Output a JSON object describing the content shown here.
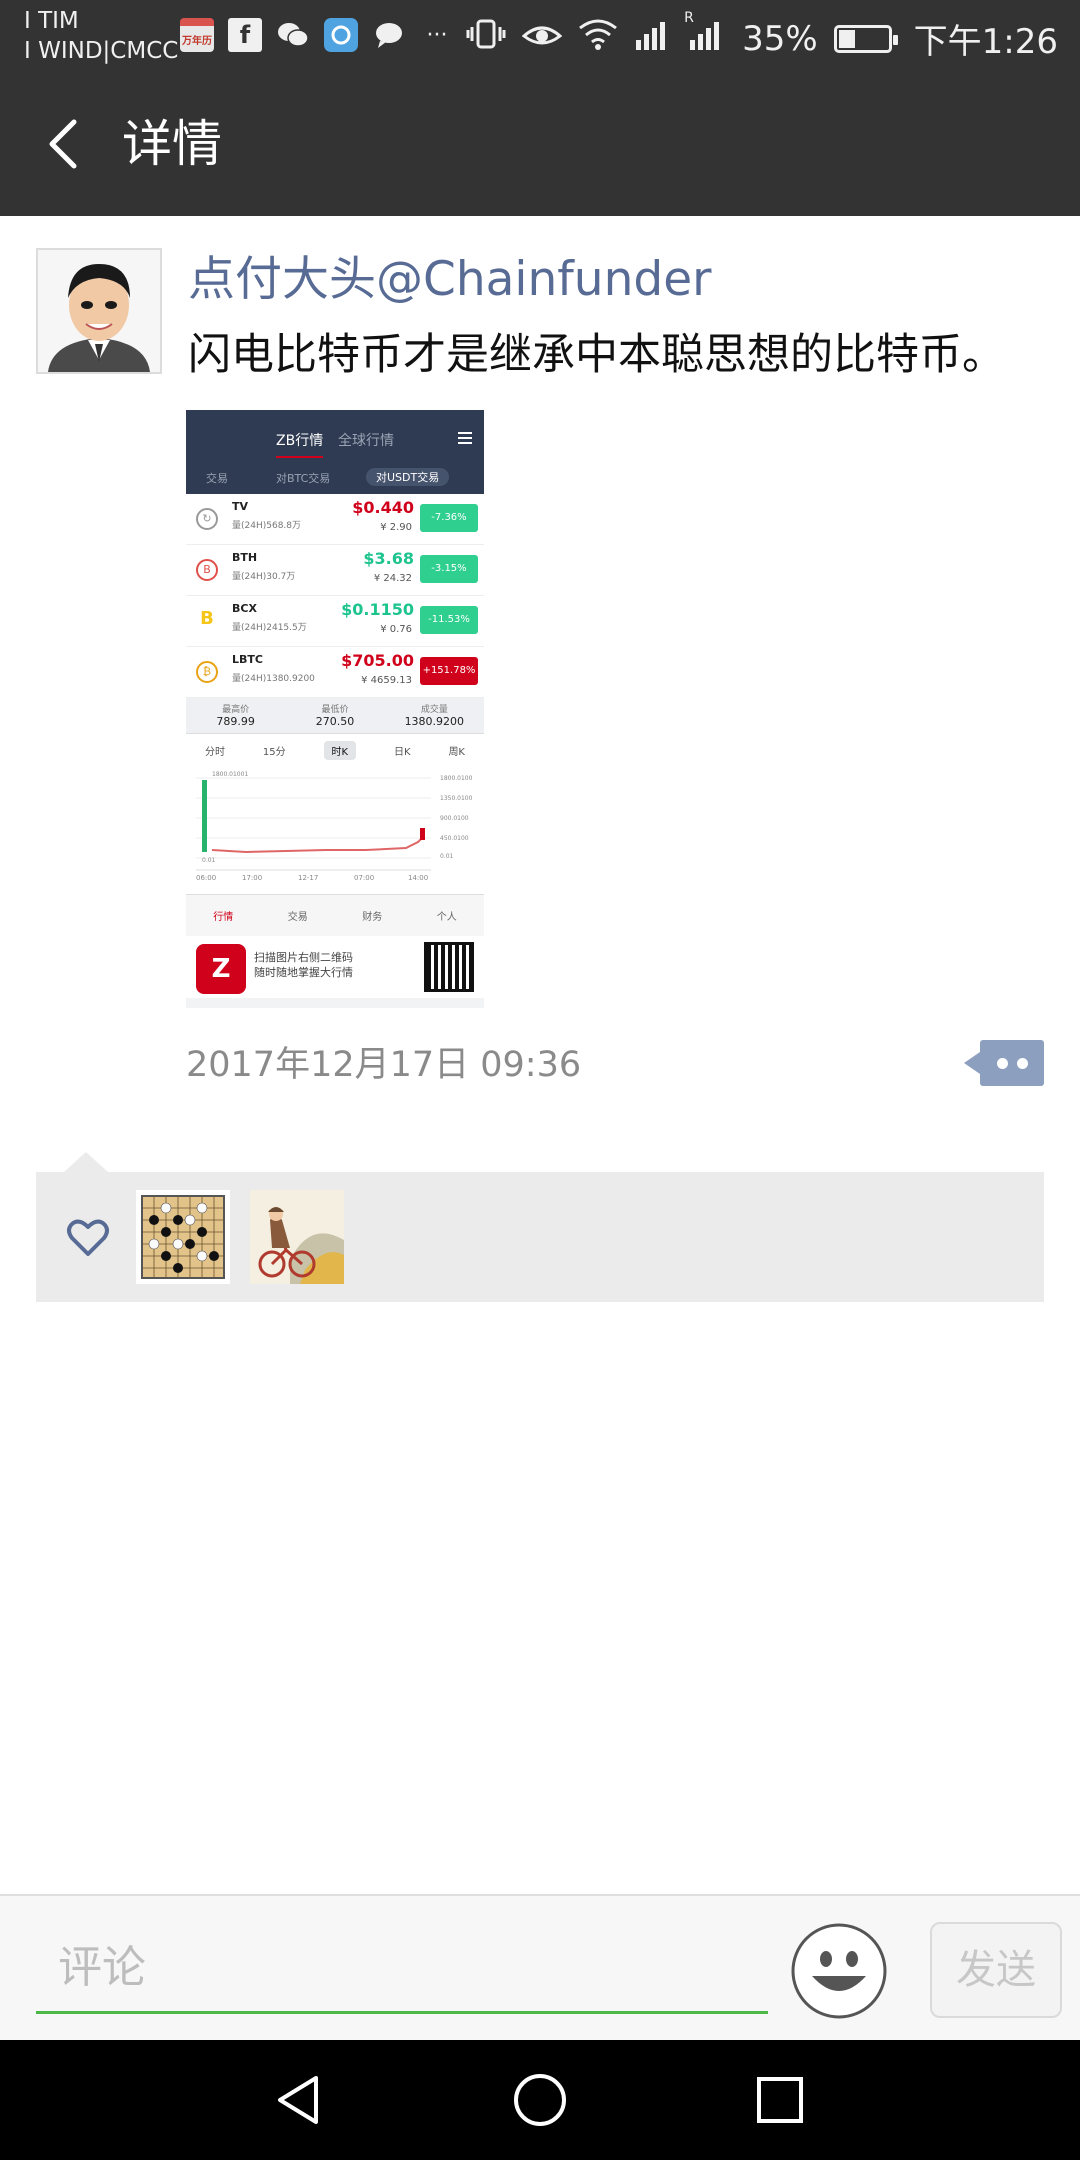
{
  "status_bar": {
    "carrier_line1": "I TIM",
    "carrier_line2": "I WIND|CMCC",
    "calendar_icon_text": "万年历",
    "signal_type": "R",
    "battery": "35%",
    "battery_level": 0.35,
    "time": "下午1:26",
    "more_notifications": "···"
  },
  "header": {
    "title": "详情"
  },
  "post": {
    "author": "点付大头@Chainfunder",
    "text": "闪电比特币才是继承中本聪思想的比特币。",
    "timestamp": "2017年12月17日 09:36",
    "image": {
      "tabs": [
        "ZB行情",
        "全球行情"
      ],
      "subtabs": [
        "交易",
        "对BTC交易",
        "对USDT交易"
      ],
      "rows": [
        {
          "name": "TV",
          "volume": "量(24H)568.8万",
          "price": "$0.440",
          "cny": "¥ 2.90",
          "change": "-7.36%",
          "price_color": "up",
          "change_color": "down",
          "coin": "↻"
        },
        {
          "name": "BTH",
          "volume": "量(24H)30.7万",
          "price": "$3.68",
          "cny": "¥ 24.32",
          "change": "-3.15%",
          "price_color": "down",
          "change_color": "down",
          "coin": "B"
        },
        {
          "name": "BCX",
          "volume": "量(24H)2415.5万",
          "price": "$0.1150",
          "cny": "¥ 0.76",
          "change": "-11.53%",
          "price_color": "down",
          "change_color": "down",
          "coin": "B"
        },
        {
          "name": "LBTC",
          "volume": "量(24H)1380.9200",
          "price": "$705.00",
          "cny": "¥ 4659.13",
          "change": "+151.78%",
          "price_color": "up",
          "change_color": "up",
          "coin": "₿"
        }
      ],
      "stats": [
        {
          "label": "最高价",
          "value": "789.99"
        },
        {
          "label": "最低价",
          "value": "270.50"
        },
        {
          "label": "成交量",
          "value": "1380.9200"
        }
      ],
      "periods": [
        "分时",
        "15分",
        "时K",
        "日K",
        "周K"
      ],
      "chart_y_labels": [
        "1800.0100",
        "1350.0100",
        "900.0100",
        "450.0100",
        "0.01"
      ],
      "chart_x_labels": [
        "06:00",
        "17:00",
        "12-17",
        "07:00",
        "14:00"
      ],
      "chart_top_label": "1800.01001",
      "chart_bottom_label": "0.01",
      "nav": [
        "行情",
        "交易",
        "财务",
        "个人"
      ],
      "footer_line1": "扫描图片右侧二维码",
      "footer_line2": "随时随地掌握大行情"
    }
  },
  "comment_bar": {
    "placeholder": "评论",
    "send_label": "发送"
  }
}
